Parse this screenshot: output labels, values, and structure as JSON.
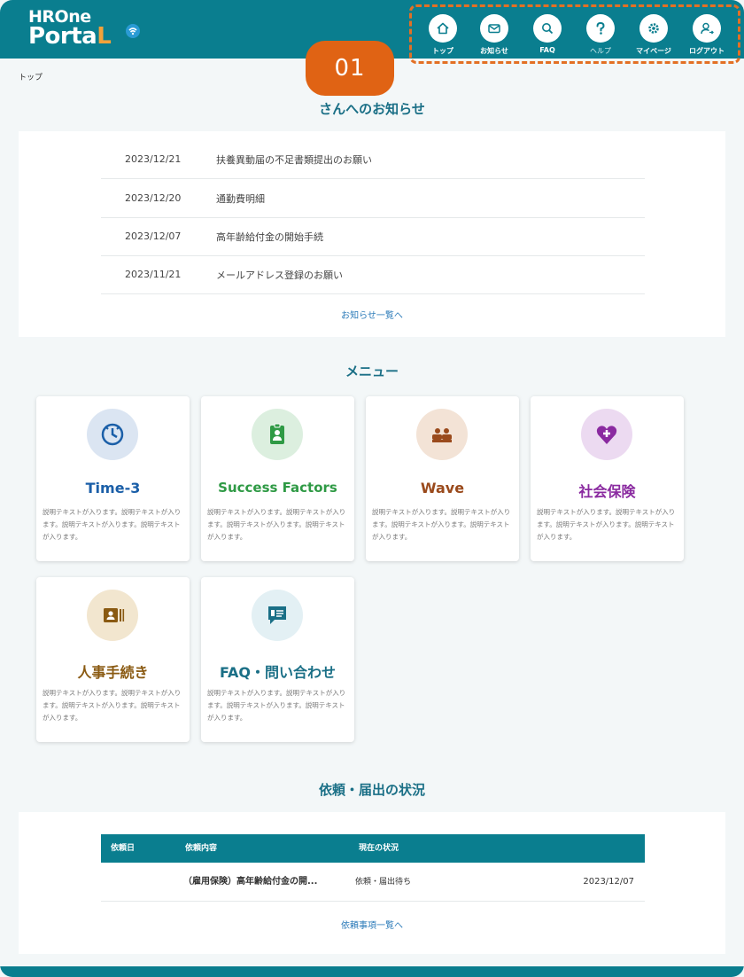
{
  "header": {
    "logo": {
      "line1_a": "HR",
      "line1_b": "One",
      "line2_a": "Porta",
      "line2_b": "L"
    },
    "nav": [
      {
        "label": "トップ",
        "icon": "home-icon"
      },
      {
        "label": "お知らせ",
        "icon": "mail-icon"
      },
      {
        "label": "FAQ",
        "icon": "search-icon"
      },
      {
        "label": "ヘルプ",
        "icon": "help-icon"
      },
      {
        "label": "マイページ",
        "icon": "gear-icon"
      },
      {
        "label": "ログアウト",
        "icon": "user-icon"
      }
    ],
    "callout_badge": "01"
  },
  "breadcrumb": "トップ",
  "news": {
    "title": "さんへのお知らせ",
    "items": [
      {
        "date": "2023/12/21",
        "title": "扶養異動届の不足書類提出のお願い"
      },
      {
        "date": "2023/12/20",
        "title": "通勤費明細"
      },
      {
        "date": "2023/12/07",
        "title": "高年齢給付金の開始手続"
      },
      {
        "date": "2023/11/21",
        "title": "メールアドレス登録のお願い"
      }
    ],
    "more_link": "お知らせ一覧へ"
  },
  "menu": {
    "title": "メニュー",
    "cards": [
      {
        "title": "Time-3",
        "color": "#1b5fa8",
        "icon": "clock-icon",
        "bg": "#dbe5f2",
        "desc": "説明テキストが入ります。説明テキストが入ります。説明テキストが入ります。説明テキストが入ります。"
      },
      {
        "title": "Success Factors",
        "color": "#2f9a45",
        "icon": "id-badge-icon",
        "bg": "#dcefdf",
        "desc": "説明テキストが入ります。説明テキストが入ります。説明テキストが入ります。説明テキストが入ります。"
      },
      {
        "title": "Wave",
        "color": "#9a4a1c",
        "icon": "people-icon",
        "bg": "#f3e3d6",
        "desc": "説明テキストが入ります。説明テキストが入ります。説明テキストが入ります。説明テキストが入ります。"
      },
      {
        "title": "社会保険",
        "color": "#8a2aa0",
        "icon": "heart-shield-icon",
        "bg": "#ecdaf1",
        "desc": "説明テキストが入ります。説明テキストが入ります。説明テキストが入ります。説明テキストが入ります。"
      },
      {
        "title": "人事手続き",
        "color": "#8a5a12",
        "icon": "profile-card-icon",
        "bg": "#f2e6cf",
        "desc": "説明テキストが入ります。説明テキストが入ります。説明テキストが入ります。説明テキストが入ります。"
      },
      {
        "title": "FAQ・問い合わせ",
        "color": "#1a6f86",
        "icon": "chat-list-icon",
        "bg": "#e3f0f4",
        "desc": "説明テキストが入ります。説明テキストが入ります。説明テキストが入ります。説明テキストが入ります。"
      }
    ]
  },
  "requests": {
    "title": "依頼・届出の状況",
    "columns": [
      "依頼日",
      "依頼内容",
      "現在の状況"
    ],
    "rows": [
      {
        "date": "",
        "content": "（雇用保険）高年齢給付金の開...",
        "status": "依頼・届出待ち",
        "due": "2023/12/07"
      }
    ],
    "more_link": "依頼事項一覧へ"
  },
  "colors": {
    "primary": "#0a7e8f",
    "callout": "#e06314",
    "title": "#1a6f86"
  }
}
